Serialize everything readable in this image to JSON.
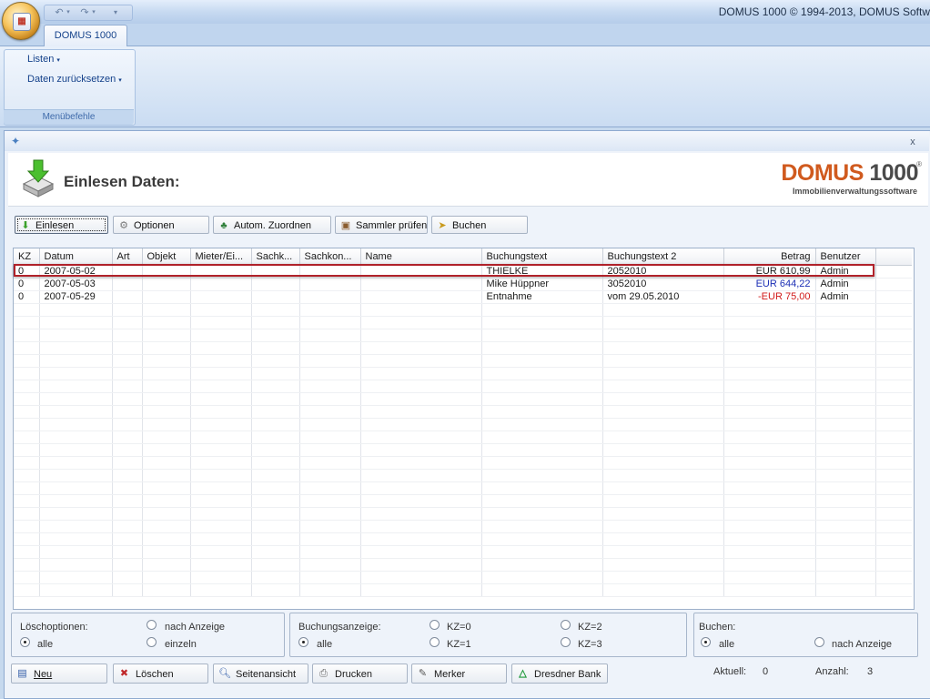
{
  "app": {
    "title": "DOMUS 1000 © 1994-2013, DOMUS Softw",
    "tab": "DOMUS 1000"
  },
  "ribbon": {
    "items": [
      {
        "label": "Listen"
      },
      {
        "label": "Daten zurücksetzen"
      }
    ],
    "group_label": "Menübefehle"
  },
  "doc": {
    "close_label": "x",
    "page_title": "Einlesen Daten:",
    "logo_main": "DOMUS",
    "logo_num": "1000",
    "logo_reg": "®",
    "logo_sub": "Immobilienverwaltungssoftware"
  },
  "toolbar": {
    "einlesen": "Einlesen",
    "optionen": "Optionen",
    "zuordnen": "Autom. Zuordnen",
    "sammler": "Sammler prüfen",
    "buchen": "Buchen"
  },
  "grid": {
    "columns": [
      "KZ",
      "Datum",
      "Art",
      "Objekt",
      "Mieter/Ei...",
      "Sachk...",
      "Sachkon...",
      "Name",
      "Buchungstext",
      "Buchungstext 2",
      "Betrag",
      "Benutzer"
    ],
    "rows": [
      {
        "kz": "0",
        "datum": "2007-05-02",
        "art": "",
        "objekt": "",
        "mieter": "",
        "sachk": "",
        "sachkon": "",
        "name": "",
        "text": "THIELKE",
        "text2": "2052010",
        "betrag": "EUR 610,99",
        "benutzer": "Admin"
      },
      {
        "kz": "0",
        "datum": "2007-05-03",
        "art": "",
        "objekt": "",
        "mieter": "",
        "sachk": "",
        "sachkon": "",
        "name": "",
        "text": "Mike Hüppner",
        "text2": "3052010",
        "betrag": "EUR 644,22",
        "benutzer": "Admin"
      },
      {
        "kz": "0",
        "datum": "2007-05-29",
        "art": "",
        "objekt": "",
        "mieter": "",
        "sachk": "",
        "sachkon": "",
        "name": "",
        "text": "Entnahme",
        "text2": "vom 29.05.2010",
        "betrag": "-EUR 75,00",
        "benutzer": "Admin"
      }
    ]
  },
  "loesch": {
    "label": "Löschoptionen:",
    "opt_alle": "alle",
    "opt_nach": "nach Anzeige",
    "opt_einzeln": "einzeln"
  },
  "buchungsanzeige": {
    "label": "Buchungsanzeige:",
    "opt_alle": "alle",
    "opt_kz0": "KZ=0",
    "opt_kz1": "KZ=1",
    "opt_kz2": "KZ=2",
    "opt_kz3": "KZ=3"
  },
  "buchen": {
    "label": "Buchen:",
    "opt_alle": "alle",
    "opt_nach": "nach Anzeige"
  },
  "bottom": {
    "neu": "Neu",
    "loeschen": "Löschen",
    "seitenansicht": "Seitenansicht",
    "drucken": "Drucken",
    "merker": "Merker",
    "bank": "Dresdner Bank",
    "aktuell_label": "Aktuell:",
    "aktuell_value": "0",
    "anzahl_label": "Anzahl:",
    "anzahl_value": "3"
  },
  "colors": {
    "highlight_border": "#b0222a",
    "amount_blue": "#1c2fb5",
    "amount_red": "#d11a1a",
    "logo_orange": "#d05a1e"
  }
}
